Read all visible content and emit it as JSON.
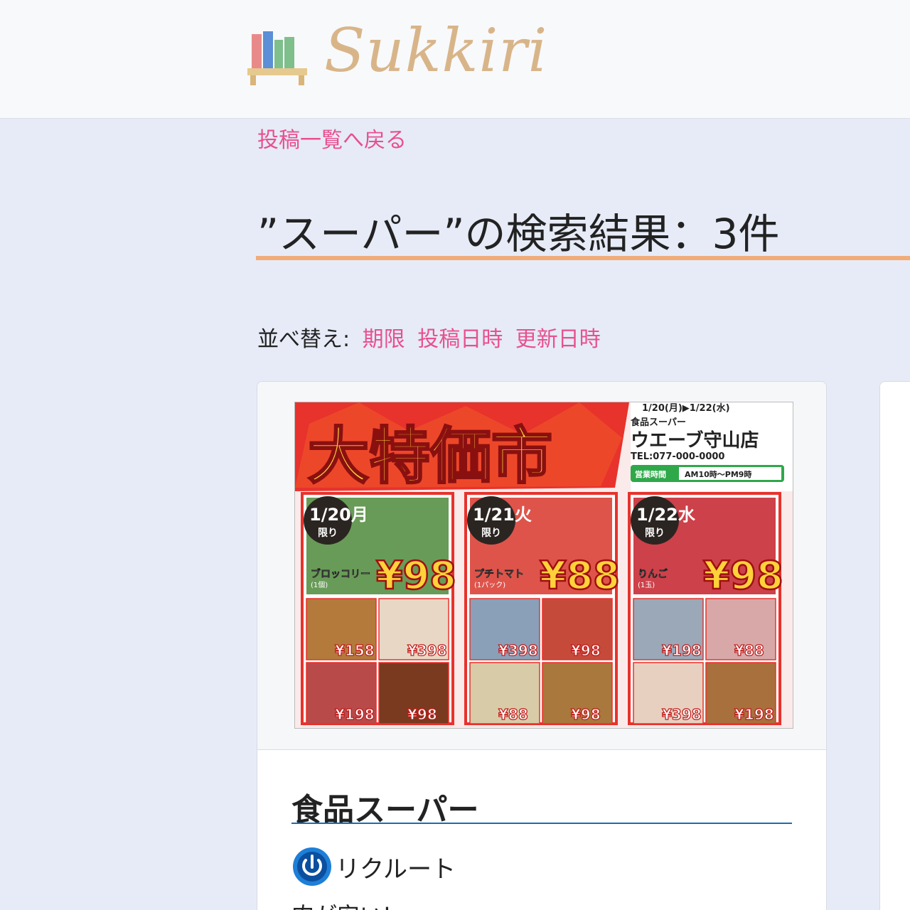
{
  "header": {
    "logo_text": "Sukkiri"
  },
  "nav": {
    "back_link": "投稿一覧へ戻る"
  },
  "search": {
    "title": "”スーパー”の検索結果：3件"
  },
  "sort": {
    "label": "並べ替え:",
    "options": [
      "期限",
      "投稿日時",
      "更新日時"
    ]
  },
  "post": {
    "title": "食品スーパー",
    "author": "リクルート",
    "snippet": "肉が安い!",
    "flyer": {
      "headline": "大特価市",
      "dates": "1/20(月)▶1/22(水)",
      "store_type": "食品スーパー",
      "store_name": "ウエーブ守山店",
      "tel": "TEL:077-000-0000",
      "hours_label": "営業時間",
      "hours": "AM10時〜PM9時",
      "days": [
        {
          "date": "1/20",
          "weekday": "月",
          "limit": "限り",
          "product": "ブロッコリー",
          "unit": "(1個)",
          "price": "98",
          "items": [
            {
              "price": "158"
            },
            {
              "price": "398"
            },
            {
              "price": "198"
            },
            {
              "price": "98"
            }
          ]
        },
        {
          "date": "1/21",
          "weekday": "火",
          "limit": "限り",
          "product": "プチトマト",
          "unit": "(1パック)",
          "price": "88",
          "items": [
            {
              "price": "398"
            },
            {
              "price": "98"
            },
            {
              "price": "88"
            },
            {
              "price": "98"
            }
          ]
        },
        {
          "date": "1/22",
          "weekday": "水",
          "limit": "限り",
          "product": "りんご",
          "unit": "(1玉)",
          "price": "98",
          "items": [
            {
              "price": "198"
            },
            {
              "price": "88"
            },
            {
              "price": "398"
            },
            {
              "price": "198"
            }
          ]
        }
      ]
    }
  },
  "colors": {
    "accent_pink": "#e8508e",
    "title_rule": "#f0ad7a",
    "card_rule": "#1f6bb0",
    "logo": "#d8b589",
    "page_bg": "#e6ebf7"
  }
}
